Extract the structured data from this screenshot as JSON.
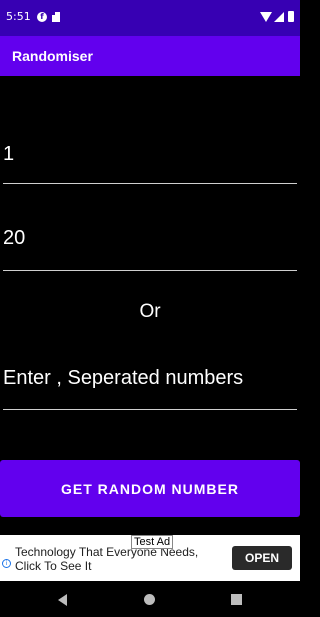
{
  "status_bar": {
    "time": "5:51",
    "notification_icons": [
      "f-badge-icon",
      "sd-card-icon"
    ],
    "system_icons": [
      "wifi-icon",
      "signal-icon",
      "battery-icon"
    ]
  },
  "app_bar": {
    "title": "Randomiser"
  },
  "form": {
    "min_value": "1",
    "max_value": "20",
    "or_label": "Or",
    "list_placeholder": "Enter , Seperated numbers"
  },
  "button": {
    "label": "GET RANDOM NUMBER"
  },
  "ad": {
    "badge": "Test Ad",
    "text": "Technology That Everyone Needs, Click To See It",
    "cta": "OPEN"
  },
  "nav_bar": {
    "buttons": [
      "back-icon",
      "home-icon",
      "recents-icon"
    ]
  },
  "colors": {
    "status_bar": "#3700b3",
    "primary": "#6200ee",
    "background": "#000000"
  }
}
